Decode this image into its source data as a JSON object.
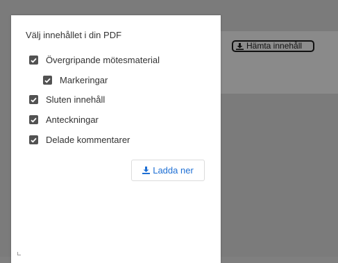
{
  "panel": {
    "title": "Välj innehållet i din PDF",
    "options": [
      {
        "label": "Övergripande mötesmaterial",
        "checked": true
      },
      {
        "label": "Markeringar",
        "checked": true
      },
      {
        "label": "Sluten innehåll",
        "checked": true
      },
      {
        "label": "Anteckningar",
        "checked": true
      },
      {
        "label": "Delade kommentarer",
        "checked": true
      }
    ],
    "download_label": "Ladda ner"
  },
  "toolbar": {
    "fetch_label": "Hämta innehåll"
  },
  "icons": {
    "download": "download-icon",
    "checkbox": "checkmark-icon"
  },
  "colors": {
    "accent": "#1e6fd4",
    "checkbox": "#525252"
  }
}
